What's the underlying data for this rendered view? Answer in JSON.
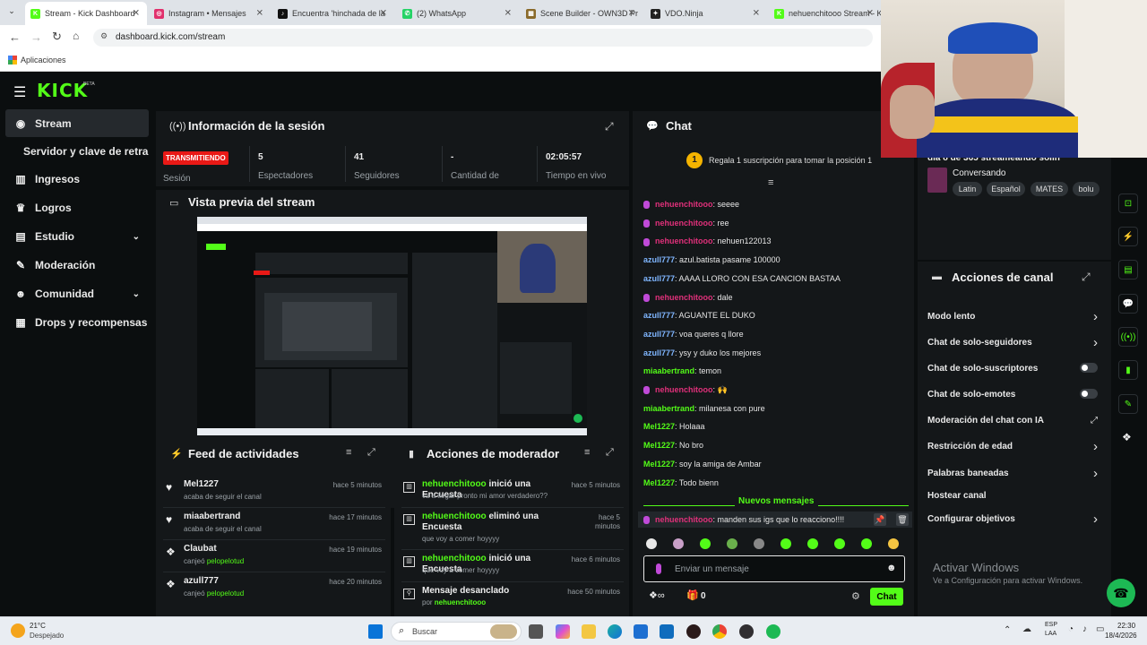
{
  "browser": {
    "tabs": [
      {
        "title": "Stream - Kick Dashboard",
        "color": "#53fc18",
        "glyph": "K",
        "active": true
      },
      {
        "title": "Instagram • Mensajes",
        "color": "#e1306c",
        "glyph": "◎"
      },
      {
        "title": "Encuentra 'hinchada de la",
        "color": "#111111",
        "glyph": "♪"
      },
      {
        "title": "(2) WhatsApp",
        "color": "#25d366",
        "glyph": "✆"
      },
      {
        "title": "Scene Builder - OWN3D Pr",
        "color": "#8a6a2a",
        "glyph": "▦"
      },
      {
        "title": "VDO.Ninja",
        "color": "#222222",
        "glyph": "✦"
      },
      {
        "title": "nehuenchitooo Stream - K",
        "color": "#53fc18",
        "glyph": "K"
      }
    ],
    "url": "dashboard.kick.com/stream",
    "bookmarks_label": "Aplicaciones"
  },
  "app": {
    "logo": "KICK",
    "logo_beta": "BETA",
    "sidebar": [
      {
        "label": "Stream",
        "icon": "stream-icon",
        "glyph": "◉",
        "active": true
      },
      {
        "label": "Servidor y clave de retransmisión",
        "icon": "",
        "glyph": ""
      },
      {
        "label": "Ingresos",
        "icon": "chart-icon",
        "glyph": "▥"
      },
      {
        "label": "Logros",
        "icon": "trophy-icon",
        "glyph": "♛"
      },
      {
        "label": "Estudio",
        "icon": "studio-icon",
        "glyph": "▤",
        "chevron": true
      },
      {
        "label": "Moderación",
        "icon": "wrench-icon",
        "glyph": "✎"
      },
      {
        "label": "Comunidad",
        "icon": "community-icon",
        "glyph": "☻",
        "chevron": true
      },
      {
        "label": "Drops y recompensas",
        "icon": "drops-icon",
        "glyph": "▦"
      }
    ],
    "session": {
      "title": "Información de la sesión",
      "status_badge": "TRANSMITIENDO",
      "status_label": "Sesión",
      "stats": [
        {
          "value": "5",
          "label": "Espectadores"
        },
        {
          "value": "41",
          "label": "Seguidores"
        },
        {
          "value": "-",
          "label": "Cantidad de"
        },
        {
          "value": "02:05:57",
          "label": "Tiempo en vivo"
        }
      ]
    },
    "preview": {
      "title": "Vista previa del stream"
    },
    "feed": {
      "title": "Feed de actividades",
      "items": [
        {
          "user": "Mel1227",
          "text": "acaba de seguir el canal",
          "time": "hace 5 minutos",
          "icon": "heart-icon",
          "glyph": "♥"
        },
        {
          "user": "miaabertrand",
          "text": "acaba de seguir el canal",
          "time": "hace 17 minutos",
          "icon": "heart-icon",
          "glyph": "♥"
        },
        {
          "user": "Claubat",
          "text": "canjeó",
          "highlight": "pelopelotud",
          "time": "hace 19 minutos",
          "icon": "points-icon",
          "glyph": "❖"
        },
        {
          "user": "azull777",
          "text": "canjeó",
          "highlight": "pelopelotud",
          "time": "hace 20 minutos",
          "icon": "points-icon",
          "glyph": "❖"
        }
      ]
    },
    "mod_actions": {
      "title": "Acciones de moderador",
      "items": [
        {
          "user": "nehuenchitooo",
          "action": "inició una Encuesta",
          "detail": "va a llegar pronto mi amor verdadero??",
          "time": "hace 5 minutos"
        },
        {
          "user": "nehuenchitooo",
          "action": "eliminó una Encuesta",
          "detail": "que voy a comer hoyyyy",
          "time": "hace 5 minutos"
        },
        {
          "user": "nehuenchitooo",
          "action": "inició una Encuesta",
          "detail": "que voy a comer hoyyyy",
          "time": "hace 6 minutos"
        },
        {
          "user": "",
          "action": "Mensaje desanclado",
          "detail_prefix": "por",
          "detail": "nehuenchitooo",
          "time": "hace 50 minutos"
        }
      ]
    },
    "chat": {
      "title": "Chat",
      "promo_rank": "1",
      "promo": "Regala 1 suscripción para tomar la posición 1",
      "messages": [
        {
          "user": "nehuenchitooo",
          "text": ": seeee",
          "mic": true,
          "color": "pink"
        },
        {
          "user": "nehuenchitooo",
          "text": ": ree",
          "mic": true,
          "color": "pink"
        },
        {
          "user": "nehuenchitooo",
          "text": ": nehuen122013",
          "mic": true,
          "color": "pink"
        },
        {
          "user": "azull777",
          "text": ": azul.batista pasame 100000",
          "color": "blue"
        },
        {
          "user": "azull777",
          "text": ": AAAA LLORO CON ESA CANCION BASTAA",
          "color": "blue"
        },
        {
          "user": "nehuenchitooo",
          "text": ": dale",
          "mic": true,
          "color": "pink"
        },
        {
          "user": "azull777",
          "text": ": AGUANTE EL DUKO",
          "color": "blue"
        },
        {
          "user": "azull777",
          "text": ": voa queres q llore",
          "color": "blue"
        },
        {
          "user": "azull777",
          "text": ": ysy y duko los mejores",
          "color": "blue"
        },
        {
          "user": "miaabertrand",
          "text": ": temon",
          "color": "green"
        },
        {
          "user": "nehuenchitooo",
          "text": ": 🙌",
          "mic": true,
          "color": "pink"
        },
        {
          "user": "miaabertrand",
          "text": ": milanesa con pure",
          "color": "green"
        },
        {
          "user": "Mel1227",
          "text": ": Holaaa",
          "color": "green"
        },
        {
          "user": "Mel1227",
          "text": ": No bro",
          "color": "green"
        },
        {
          "user": "Mel1227",
          "text": ": soy la amiga de Ambar",
          "color": "green"
        },
        {
          "user": "Mel1227",
          "text": ": Todo bienn",
          "color": "green"
        }
      ],
      "new_messages": "Nuevos mensajes",
      "last_message": {
        "user": "nehuenchitooo",
        "text": ": manden sus igs que lo reacciono!!!!"
      },
      "input_placeholder": "Enviar un mensaje",
      "footer_count": "0",
      "chat_button": "Chat"
    },
    "stream_info": {
      "title_partial": "día 8 de 365 streameando solin",
      "category": "Conversando",
      "tags": [
        "Latin",
        "Español",
        "MATES",
        "bolu"
      ]
    },
    "channel_actions": {
      "title": "Acciones de canal",
      "items": [
        {
          "label": "Modo lento",
          "control": "chevron"
        },
        {
          "label": "Chat de solo-seguidores",
          "control": "chevron"
        },
        {
          "label": "Chat de solo-suscriptores",
          "control": "toggle"
        },
        {
          "label": "Chat de solo-emotes",
          "control": "toggle"
        },
        {
          "label": "Moderación del chat con IA",
          "control": "external"
        },
        {
          "label": "Restricción de edad",
          "control": "chevron"
        },
        {
          "label": "Palabras baneadas",
          "control": "chevron"
        },
        {
          "label": "Hostear canal",
          "control": "none"
        },
        {
          "label": "Configurar objetivos",
          "control": "chevron"
        }
      ]
    },
    "watermark": {
      "title": "Activar Windows",
      "subtitle": "Ve a Configuración para activar Windows."
    }
  },
  "taskbar": {
    "weather_temp": "21°C",
    "weather_desc": "Despejado",
    "search_placeholder": "Buscar",
    "lang_top": "ESP",
    "lang_bottom": "LAA",
    "time": "22:30",
    "date": "18/4/2026"
  },
  "colors": {
    "accent": "#53fc18",
    "live_badge": "#e91916",
    "panel": "#141719",
    "background": "#0b0e0f"
  }
}
